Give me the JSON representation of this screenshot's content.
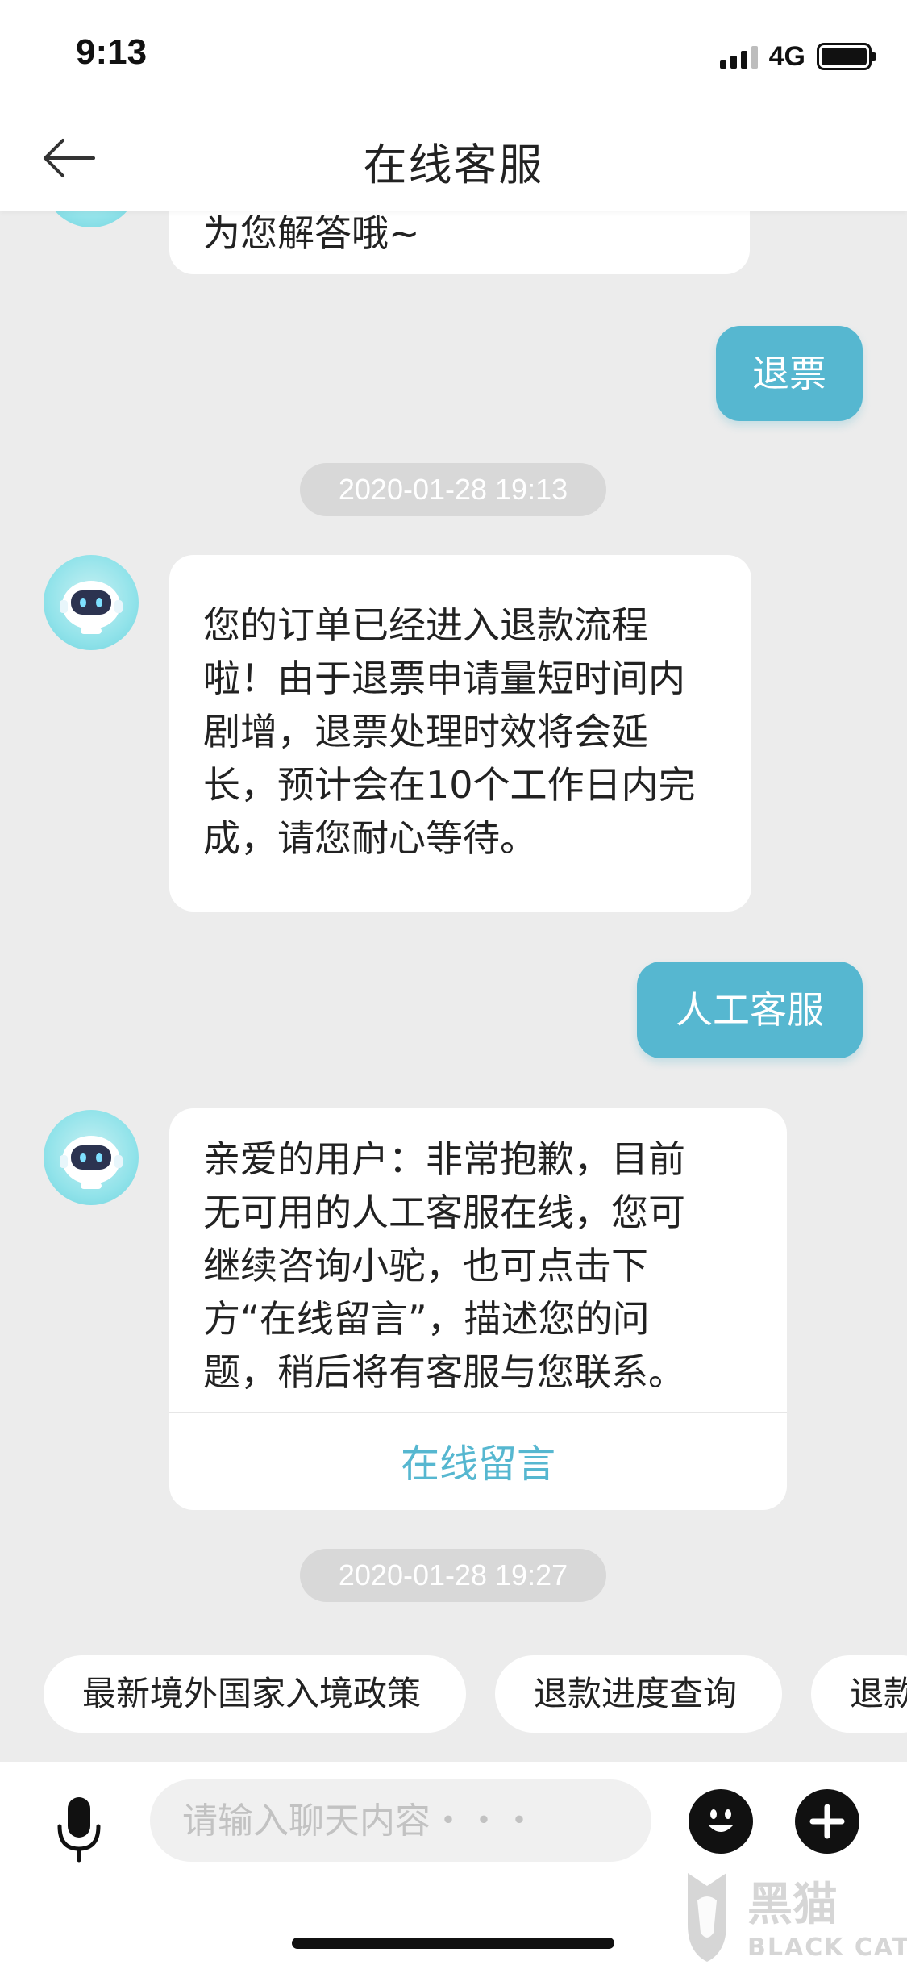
{
  "status_bar": {
    "time": "9:13",
    "network": "4G"
  },
  "header": {
    "title": "在线客服",
    "back_icon": "back-arrow-icon"
  },
  "messages": [
    {
      "side": "left",
      "lines": [
        "为您解答哦~"
      ]
    },
    {
      "side": "right",
      "text": "退票"
    },
    {
      "type": "timestamp",
      "text": "2020-01-28 19:13"
    },
    {
      "side": "left",
      "lines": [
        "您的订单已经进入退款流程",
        "啦！由于退票申请量短时间内",
        "剧增，退票处理时效将会延",
        "长，预计会在10个工作日内完",
        "成，请您耐心等待。"
      ]
    },
    {
      "side": "right",
      "text": "人工客服"
    },
    {
      "side": "left",
      "lines": [
        "亲爱的用户：非常抱歉，目前",
        "无可用的人工客服在线，您可",
        "继续咨询小驼，也可点击下",
        "方“在线留言”，描述您的问",
        "题，稍后将有客服与您联系。"
      ],
      "action": "在线留言"
    },
    {
      "type": "timestamp",
      "text": "2020-01-28 19:27"
    }
  ],
  "quick_replies": [
    "最新境外国家入境政策",
    "退款进度查询",
    "退款"
  ],
  "input": {
    "placeholder": "请输入聊天内容・・・"
  },
  "icons": {
    "mic": "microphone-icon",
    "emoji": "emoji-icon",
    "plus": "plus-icon"
  },
  "watermark": {
    "text_cn": "黑猫",
    "text_en": "BLACK CAT"
  },
  "colors": {
    "accent": "#56b7d0",
    "background": "#ececec",
    "timestamp_bg": "#d8d8d8"
  }
}
